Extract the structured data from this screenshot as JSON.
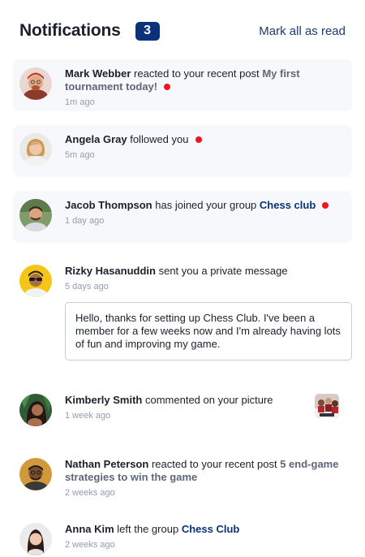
{
  "header": {
    "title": "Notifications",
    "unread_count": "3",
    "mark_all_label": "Mark all as read"
  },
  "notifications": [
    {
      "actor": "Mark Webber",
      "verb": "reacted to your recent post",
      "target": "My first tournament today!",
      "time": "1m ago",
      "unread": true,
      "avatar_icon": "avatar-mark-webber"
    },
    {
      "actor": "Angela Gray",
      "verb": "followed you",
      "target": "",
      "time": "5m ago",
      "unread": true,
      "avatar_icon": "avatar-angela-gray"
    },
    {
      "actor": "Jacob Thompson",
      "verb": "has joined your group",
      "target": "Chess club",
      "time": "1 day ago",
      "unread": true,
      "avatar_icon": "avatar-jacob-thompson"
    },
    {
      "actor": "Rizky Hasanuddin",
      "verb": "sent you a private message",
      "target": "",
      "time": "5 days ago",
      "unread": false,
      "message": "Hello, thanks for setting up Chess Club. I've been a member for a few weeks now and I'm already having lots of fun and improving my game.",
      "avatar_icon": "avatar-rizky-hasanuddin"
    },
    {
      "actor": "Kimberly Smith",
      "verb": "commented on your picture",
      "target": "",
      "time": "1 week ago",
      "unread": false,
      "avatar_icon": "avatar-kimberly-smith",
      "thumbnail_icon": "chess-picture-thumbnail"
    },
    {
      "actor": "Nathan Peterson",
      "verb": "reacted to your recent post",
      "target": "5 end-game strategies to win the game",
      "time": "2 weeks ago",
      "unread": false,
      "avatar_icon": "avatar-nathan-peterson"
    },
    {
      "actor": "Anna Kim",
      "verb": "left the group",
      "target": "Chess Club",
      "time": "2 weeks ago",
      "unread": false,
      "avatar_icon": "avatar-anna-kim"
    }
  ],
  "colors": {
    "badge_bg": "#0a327b",
    "unread_bg": "#f6f8fc",
    "unread_dot": "#f0141e",
    "heading_text": "#1c202b",
    "muted_text": "#5e6778",
    "time_text": "#939cad"
  }
}
